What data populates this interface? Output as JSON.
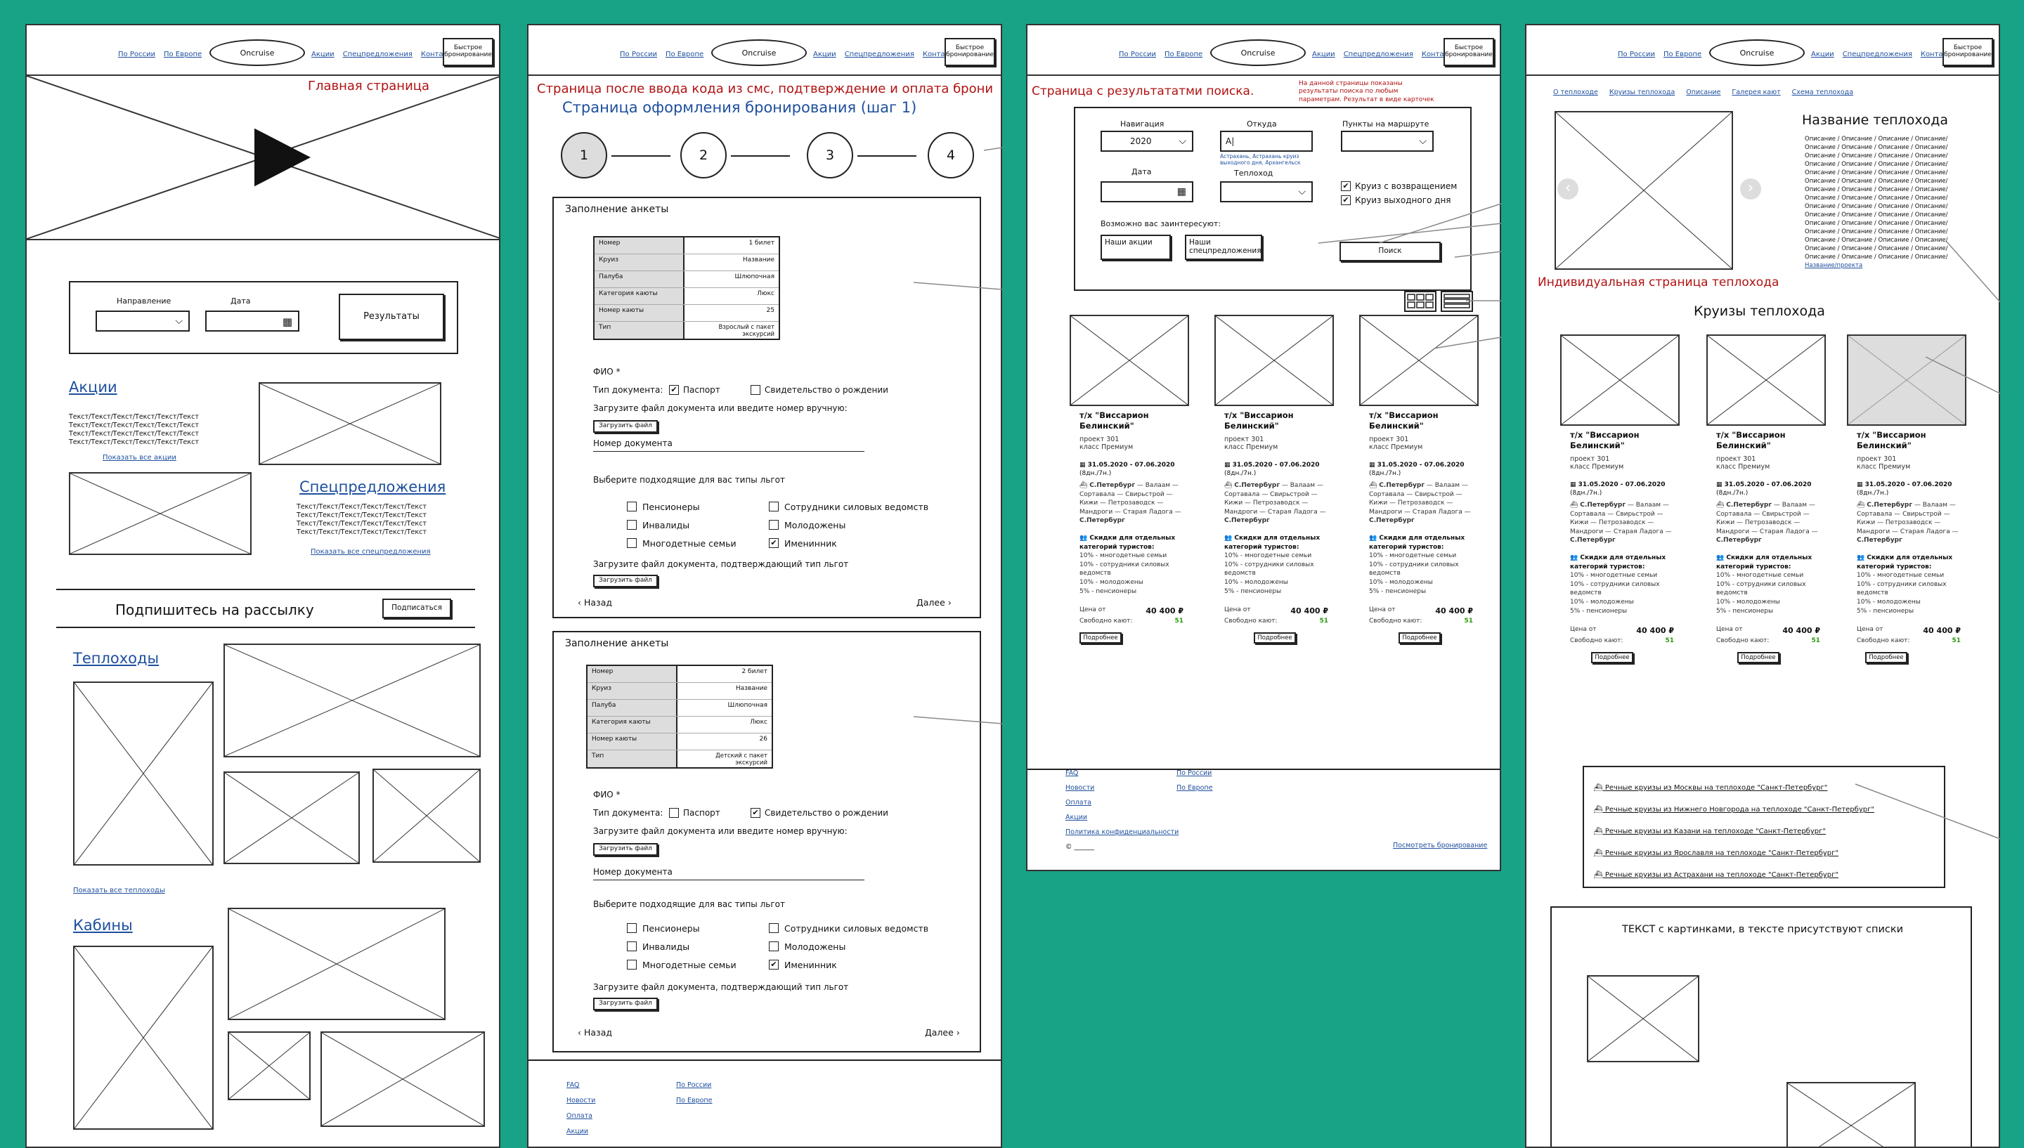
{
  "nav": {
    "links_left": [
      "По России",
      "По Европе"
    ],
    "logo": "Oncruise",
    "links_right": [
      "Акции",
      "Спецпредложения",
      "Контакты"
    ],
    "quick_booking": "Быстрое бронирование"
  },
  "board1": {
    "title": "Главная страница",
    "search": {
      "direction_label": "Направление",
      "date_label": "Дата",
      "results_button": "Результаты"
    },
    "promos": {
      "heading": "Акции",
      "text": "Текст/Текст/Текст/Текст/Текст/Текст",
      "link": "Показать все акции"
    },
    "specials": {
      "heading": "Спецпредложения",
      "text": "Текст/Текст/Текст/Текст/Текст/Текст",
      "link": "Показать все спецпредложения"
    },
    "subscribe": {
      "text": "Подпишитесь на рассылку",
      "button": "Подписаться"
    },
    "ships": {
      "heading": "Теплоходы",
      "link": "Показать все теплоходы"
    },
    "cabins": {
      "heading": "Кабины"
    }
  },
  "board2": {
    "note": "Страница после ввода кода из смс, подтверждение и оплата брони",
    "title": "Страница оформления бронирования (шаг 1)",
    "steps": [
      "1",
      "2",
      "3",
      "4"
    ],
    "forms": [
      {
        "heading": "Заполнение анкеты",
        "table": [
          [
            "Номер",
            "1 билет"
          ],
          [
            "Круиз",
            "Название"
          ],
          [
            "Палуба",
            "Шлюпочная"
          ],
          [
            "Категория каюты",
            "Люкс"
          ],
          [
            "Номер каюты",
            "25"
          ],
          [
            "Тип",
            "Взрослый с пакет экскурсий"
          ]
        ],
        "fio": "ФИО *",
        "doc_type": "Тип документа:",
        "passport": "Паспорт",
        "birth_cert": "Свидетельство о рождении",
        "upload_hint": "Загрузите файл документа или введите номер вручную:",
        "upload_button": "Загрузить файл",
        "doc_number": "Номер документа",
        "benefits_title": "Выберите подходящие для вас типы льгот",
        "benefits": [
          "Пенсионеры",
          "Сотрудники силовых ведомств",
          "Инвалиды",
          "Молодожены",
          "Многодетные семьи",
          "Именинник"
        ],
        "upload_benefit": "Загрузите файл документа, подтверждающий тип льгот",
        "back": "Назад",
        "next": "Далее"
      },
      {
        "heading": "Заполнение анкеты",
        "table": [
          [
            "Номер",
            "2 билет"
          ],
          [
            "Круиз",
            "Название"
          ],
          [
            "Палуба",
            "Шлюпочная"
          ],
          [
            "Категория каюты",
            "Люкс"
          ],
          [
            "Номер каюты",
            "26"
          ],
          [
            "Тип",
            "Детский с пакет экскурсий"
          ]
        ],
        "fio": "ФИО *",
        "doc_type": "Тип документа:",
        "passport": "Паспорт",
        "birth_cert": "Свидетельство о рождении",
        "upload_hint": "Загрузите файл документа или введите номер вручную:",
        "upload_button": "Загрузить файл",
        "doc_number": "Номер документа",
        "benefits_title": "Выберите подходящие для вас типы льгот",
        "benefits": [
          "Пенсионеры",
          "Сотрудники силовых ведомств",
          "Инвалиды",
          "Молодожены",
          "Многодетные семьи",
          "Именинник"
        ],
        "upload_benefit": "Загрузите файл документа, подтверждающий тип льгот",
        "back": "Назад",
        "next": "Далее"
      }
    ],
    "footer": {
      "col1": [
        "FAQ",
        "Новости",
        "Оплата",
        "Акции"
      ],
      "col2": [
        "По России",
        "По Европе"
      ]
    }
  },
  "board3": {
    "title": "Страница с результататми поиска.",
    "note": "На данной страницы показаны результаты поиска по любым параметрам. Результат в виде карточек",
    "filters": {
      "nav_label": "Навигация",
      "year": "2020",
      "from_label": "Откуда",
      "from_value": "А|",
      "from_suggest": "Астрахань, Астрахань круиз выходного дня, Архангельск",
      "points_label": "Пункты на маршруте",
      "date_label": "Дата",
      "ship_label": "Теплоход",
      "return_cruise": "Круиз с возвращением",
      "weekend_cruise": "Круиз выходного дня",
      "interest_label": "Возможно вас заинтересуют:",
      "our_promos": "Наши акции",
      "our_specials": "Наши спецпредложения",
      "search_button": "Поиск"
    },
    "cards": [
      {
        "name": "т/х \"Виссарион Белинский\"",
        "project": "проект 301",
        "class": "класс Премиум",
        "dates": "31.05.2020 - 07.06.2020",
        "nights": "(8дн./7н.)",
        "route_start": "С.Петербург",
        "route": "Валаам — Сортавала — Свирьстрой — Кижи — Петрозаводск — Мандроги — Старая Ладога —",
        "route_end": "С.Петербург",
        "discount_title": "Скидки для отдельных категорий туристов:",
        "discounts": [
          "10% - многодетные семьи",
          "10% - сотрудники силовых ведомств",
          "10% - молодожены",
          "5% - пенсионеры"
        ],
        "price_label": "Цена от",
        "price": "40 400 ₽",
        "free_label": "Свободно кают:",
        "free": "51",
        "more": "Подробнее"
      },
      {
        "name": "т/х \"Виссарион Белинский\"",
        "project": "проект 301",
        "class": "класс Премиум",
        "dates": "31.05.2020 - 07.06.2020",
        "nights": "(8дн./7н.)",
        "route_start": "С.Петербург",
        "route": "Валаам — Сортавала — Свирьстрой — Кижи — Петрозаводск — Мандроги — Старая Ладога —",
        "route_end": "С.Петербург",
        "discount_title": "Скидки для отдельных категорий туристов:",
        "discounts": [
          "10% - многодетные семьи",
          "10% - сотрудники силовых ведомств",
          "10% - молодожены",
          "5% - пенсионеры"
        ],
        "price_label": "Цена от",
        "price": "40 400 ₽",
        "free_label": "Свободно кают:",
        "free": "51",
        "more": "Подробнее"
      },
      {
        "name": "т/х \"Виссарион Белинский\"",
        "project": "проект 301",
        "class": "класс Премиум",
        "dates": "31.05.2020 - 07.06.2020",
        "nights": "(8дн./7н.)",
        "route_start": "С.Петербург",
        "route": "Валаам — Сортавала — Свирьстрой — Кижи — Петрозаводск — Мандроги — Старая Ладога —",
        "route_end": "С.Петербург",
        "discount_title": "Скидки для отдельных категорий туристов:",
        "discounts": [
          "10% - многодетные семьи",
          "10% - сотрудники силовых ведомств",
          "10% - молодожены",
          "5% - пенсионеры"
        ],
        "price_label": "Цена от",
        "price": "40 400 ₽",
        "free_label": "Свободно кают:",
        "free": "51",
        "more": "Подробнее"
      }
    ],
    "footer": {
      "col1": [
        "FAQ",
        "Новости",
        "Оплата",
        "Акции",
        "Политика конфиденциальности"
      ],
      "col2": [
        "По России",
        "По Европе"
      ],
      "copyright": "© ______",
      "view_booking": "Посмотреть бронирование"
    }
  },
  "board4": {
    "breadcrumb": [
      "О теплоходе",
      "Круизы теплохода",
      "Описание",
      "Галерея кают",
      "Схема теплохода"
    ],
    "ship_title": "Название теплохода",
    "desc_line": "Описание / Описание / Описание / Описание/",
    "desc_link": "Название/проекта",
    "page_label": "Индивидуальная страница теплохода",
    "cruises_title": "Круизы теплохода",
    "cruise_links": [
      "Речные круизы из Москвы на теплоходе \"Санкт-Петербург\"",
      "Речные круизы из Нижнего Новгорода на теплоходе \"Санкт-Петербург\"",
      "Речные круизы из Казани на теплоходе \"Санкт-Петербург\"",
      "Речные круизы из Ярославля на теплоходе \"Санкт-Петербург\"",
      "Речные круизы из Астрахани на теплоходе \"Санкт-Петербург\""
    ],
    "text_block": "ТЕКСТ с картинками, в тексте присутствуют списки"
  }
}
